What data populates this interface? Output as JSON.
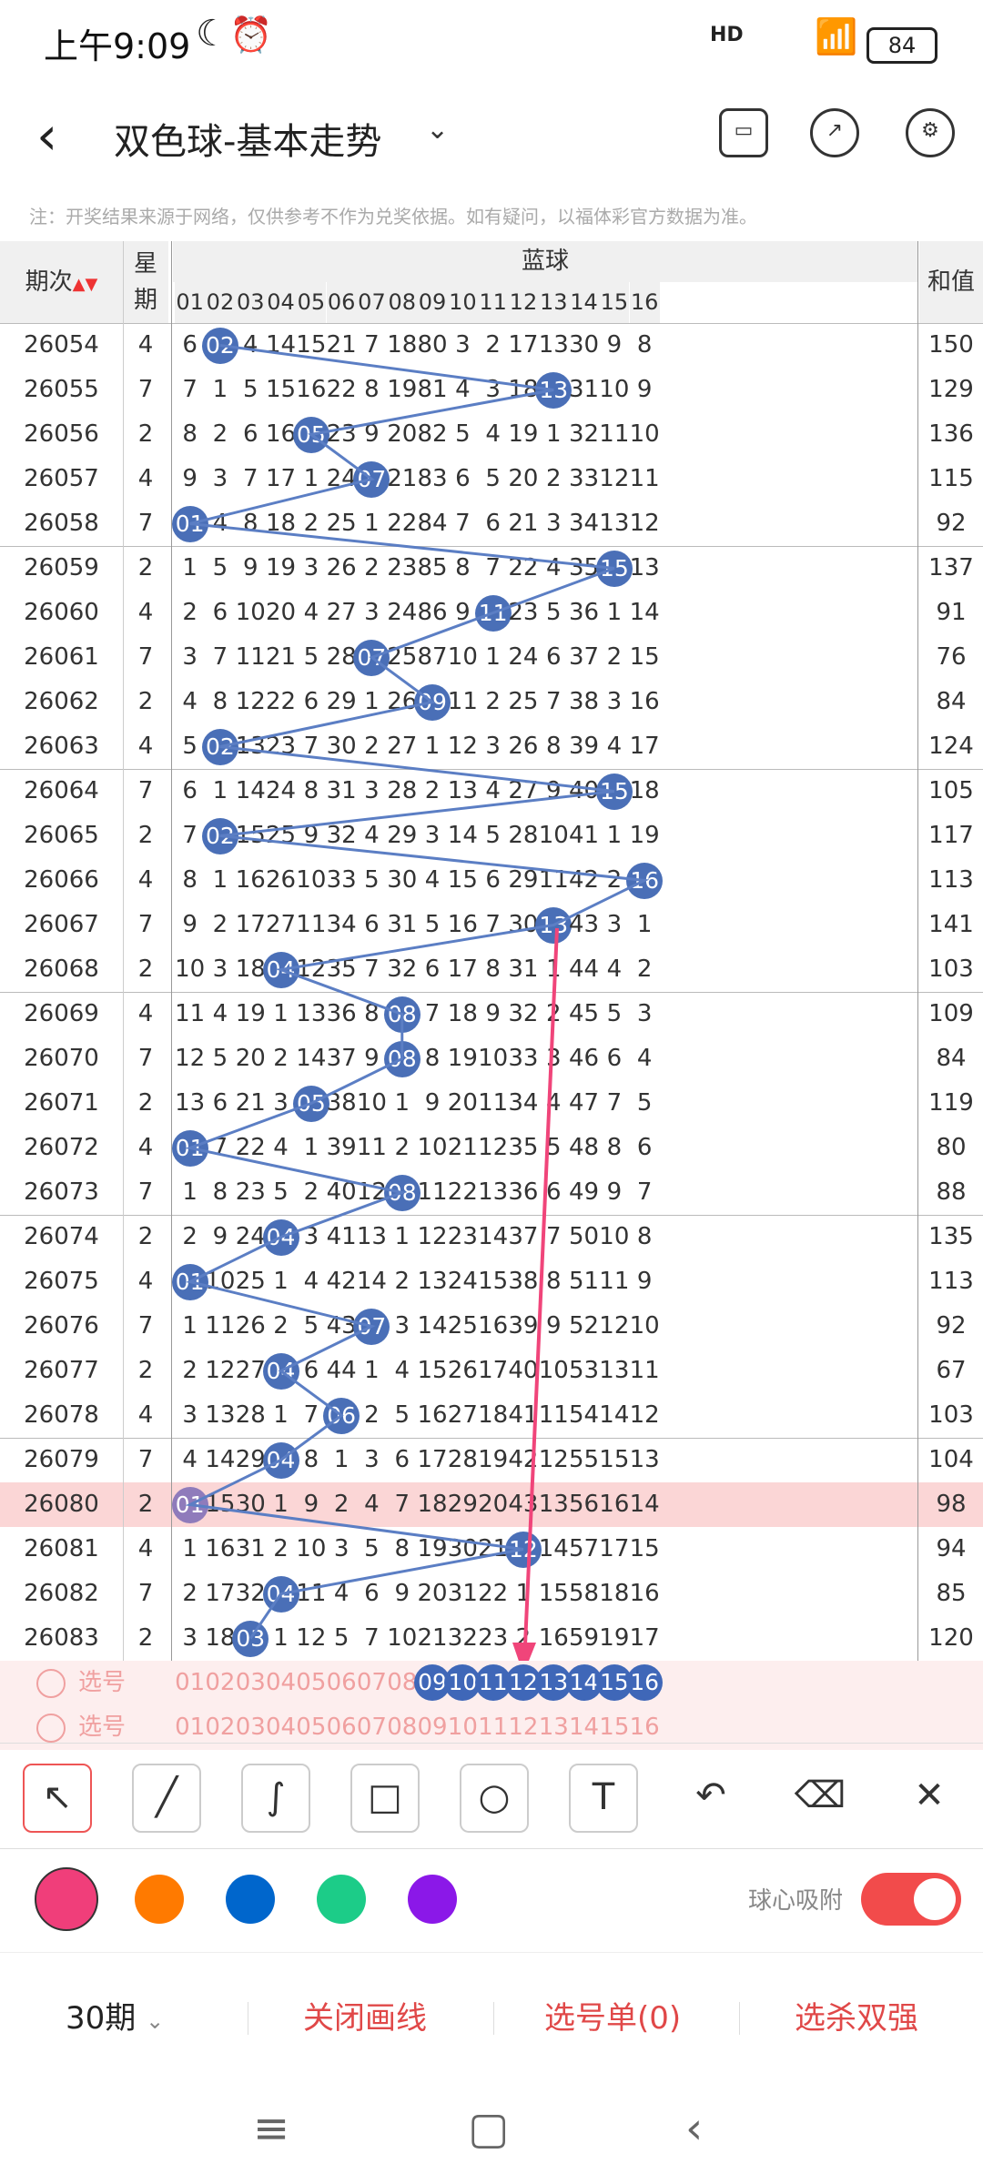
{
  "status": {
    "time": "上午9:09",
    "signal": "HD",
    "battery": "84"
  },
  "header": {
    "title": "双色球-基本走势",
    "back": "‹",
    "dropdown": "⌄"
  },
  "note": "注：开奖结果来源于网络，仅供参考不作为兑奖依据。如有疑问，以福体彩官方数据为准。",
  "table": {
    "col_issue": "期次",
    "col_week_1": "星",
    "col_week_2": "期",
    "col_blue": "蓝球",
    "col_sum": "和值",
    "blue_cols": [
      "01",
      "02",
      "03",
      "04",
      "05",
      "06",
      "07",
      "08",
      "09",
      "10",
      "11",
      "12",
      "13",
      "14",
      "15",
      "16"
    ],
    "rows": [
      {
        "issue": "26054",
        "week": "4",
        "sum": "150",
        "cells": [
          "6",
          "02",
          "4",
          "14",
          "15",
          "21",
          "7",
          "18",
          "80",
          "3",
          "2",
          "17",
          "13",
          "30",
          "9",
          "8"
        ],
        "hit": 2
      },
      {
        "issue": "26055",
        "week": "7",
        "sum": "129",
        "cells": [
          "7",
          "1",
          "5",
          "15",
          "16",
          "22",
          "8",
          "19",
          "81",
          "4",
          "3",
          "18",
          "13",
          "31",
          "10",
          "9"
        ],
        "hit": 13
      },
      {
        "issue": "26056",
        "week": "2",
        "sum": "136",
        "cells": [
          "8",
          "2",
          "6",
          "16",
          "05",
          "23",
          "9",
          "20",
          "82",
          "5",
          "4",
          "19",
          "1",
          "32",
          "11",
          "10"
        ],
        "hit": 5
      },
      {
        "issue": "26057",
        "week": "4",
        "sum": "115",
        "cells": [
          "9",
          "3",
          "7",
          "17",
          "1",
          "24",
          "07",
          "21",
          "83",
          "6",
          "5",
          "20",
          "2",
          "33",
          "12",
          "11"
        ],
        "hit": 7
      },
      {
        "issue": "26058",
        "week": "7",
        "sum": "92",
        "cells": [
          "01",
          "4",
          "8",
          "18",
          "2",
          "25",
          "1",
          "22",
          "84",
          "7",
          "6",
          "21",
          "3",
          "34",
          "13",
          "12"
        ],
        "hit": 1
      },
      {
        "issue": "26059",
        "week": "2",
        "sum": "137",
        "cells": [
          "1",
          "5",
          "9",
          "19",
          "3",
          "26",
          "2",
          "23",
          "85",
          "8",
          "7",
          "22",
          "4",
          "35",
          "15",
          "13"
        ],
        "hit": 15
      },
      {
        "issue": "26060",
        "week": "4",
        "sum": "91",
        "cells": [
          "2",
          "6",
          "10",
          "20",
          "4",
          "27",
          "3",
          "24",
          "86",
          "9",
          "11",
          "23",
          "5",
          "36",
          "1",
          "14"
        ],
        "hit": 11
      },
      {
        "issue": "26061",
        "week": "7",
        "sum": "76",
        "cells": [
          "3",
          "7",
          "11",
          "21",
          "5",
          "28",
          "07",
          "25",
          "87",
          "10",
          "1",
          "24",
          "6",
          "37",
          "2",
          "15"
        ],
        "hit": 7
      },
      {
        "issue": "26062",
        "week": "2",
        "sum": "84",
        "cells": [
          "4",
          "8",
          "12",
          "22",
          "6",
          "29",
          "1",
          "26",
          "09",
          "11",
          "2",
          "25",
          "7",
          "38",
          "3",
          "16"
        ],
        "hit": 9
      },
      {
        "issue": "26063",
        "week": "4",
        "sum": "124",
        "cells": [
          "5",
          "02",
          "13",
          "23",
          "7",
          "30",
          "2",
          "27",
          "1",
          "12",
          "3",
          "26",
          "8",
          "39",
          "4",
          "17"
        ],
        "hit": 2
      },
      {
        "issue": "26064",
        "week": "7",
        "sum": "105",
        "cells": [
          "6",
          "1",
          "14",
          "24",
          "8",
          "31",
          "3",
          "28",
          "2",
          "13",
          "4",
          "27",
          "9",
          "40",
          "15",
          "18"
        ],
        "hit": 15
      },
      {
        "issue": "26065",
        "week": "2",
        "sum": "117",
        "cells": [
          "7",
          "02",
          "15",
          "25",
          "9",
          "32",
          "4",
          "29",
          "3",
          "14",
          "5",
          "28",
          "10",
          "41",
          "1",
          "19"
        ],
        "hit": 2
      },
      {
        "issue": "26066",
        "week": "4",
        "sum": "113",
        "cells": [
          "8",
          "1",
          "16",
          "26",
          "10",
          "33",
          "5",
          "30",
          "4",
          "15",
          "6",
          "29",
          "11",
          "42",
          "2",
          "16"
        ],
        "hit": 16
      },
      {
        "issue": "26067",
        "week": "7",
        "sum": "141",
        "cells": [
          "9",
          "2",
          "17",
          "27",
          "11",
          "34",
          "6",
          "31",
          "5",
          "16",
          "7",
          "30",
          "13",
          "43",
          "3",
          "1"
        ],
        "hit": 13
      },
      {
        "issue": "26068",
        "week": "2",
        "sum": "103",
        "cells": [
          "10",
          "3",
          "18",
          "04",
          "12",
          "35",
          "7",
          "32",
          "6",
          "17",
          "8",
          "31",
          "1",
          "44",
          "4",
          "2"
        ],
        "hit": 4
      },
      {
        "issue": "26069",
        "week": "4",
        "sum": "109",
        "cells": [
          "11",
          "4",
          "19",
          "1",
          "13",
          "36",
          "8",
          "08",
          "7",
          "18",
          "9",
          "32",
          "2",
          "45",
          "5",
          "3"
        ],
        "hit": 8
      },
      {
        "issue": "26070",
        "week": "7",
        "sum": "84",
        "cells": [
          "12",
          "5",
          "20",
          "2",
          "14",
          "37",
          "9",
          "08",
          "8",
          "19",
          "10",
          "33",
          "3",
          "46",
          "6",
          "4"
        ],
        "hit": 8
      },
      {
        "issue": "26071",
        "week": "2",
        "sum": "119",
        "cells": [
          "13",
          "6",
          "21",
          "3",
          "05",
          "38",
          "10",
          "1",
          "9",
          "20",
          "11",
          "34",
          "4",
          "47",
          "7",
          "5"
        ],
        "hit": 5
      },
      {
        "issue": "26072",
        "week": "4",
        "sum": "80",
        "cells": [
          "01",
          "7",
          "22",
          "4",
          "1",
          "39",
          "11",
          "2",
          "10",
          "21",
          "12",
          "35",
          "5",
          "48",
          "8",
          "6"
        ],
        "hit": 1
      },
      {
        "issue": "26073",
        "week": "7",
        "sum": "88",
        "cells": [
          "1",
          "8",
          "23",
          "5",
          "2",
          "40",
          "12",
          "08",
          "11",
          "22",
          "13",
          "36",
          "6",
          "49",
          "9",
          "7"
        ],
        "hit": 8
      },
      {
        "issue": "26074",
        "week": "2",
        "sum": "135",
        "cells": [
          "2",
          "9",
          "24",
          "04",
          "3",
          "41",
          "13",
          "1",
          "12",
          "23",
          "14",
          "37",
          "7",
          "50",
          "10",
          "8"
        ],
        "hit": 4
      },
      {
        "issue": "26075",
        "week": "4",
        "sum": "113",
        "cells": [
          "01",
          "10",
          "25",
          "1",
          "4",
          "42",
          "14",
          "2",
          "13",
          "24",
          "15",
          "38",
          "8",
          "51",
          "11",
          "9"
        ],
        "hit": 1
      },
      {
        "issue": "26076",
        "week": "7",
        "sum": "92",
        "cells": [
          "1",
          "11",
          "26",
          "2",
          "5",
          "43",
          "07",
          "3",
          "14",
          "25",
          "16",
          "39",
          "9",
          "52",
          "12",
          "10"
        ],
        "hit": 7
      },
      {
        "issue": "26077",
        "week": "2",
        "sum": "67",
        "cells": [
          "2",
          "12",
          "27",
          "04",
          "6",
          "44",
          "1",
          "4",
          "15",
          "26",
          "17",
          "40",
          "10",
          "53",
          "13",
          "11"
        ],
        "hit": 4
      },
      {
        "issue": "26078",
        "week": "4",
        "sum": "103",
        "cells": [
          "3",
          "13",
          "28",
          "1",
          "7",
          "06",
          "2",
          "5",
          "16",
          "27",
          "18",
          "41",
          "11",
          "54",
          "14",
          "12"
        ],
        "hit": 6
      },
      {
        "issue": "26079",
        "week": "7",
        "sum": "104",
        "cells": [
          "4",
          "14",
          "29",
          "04",
          "8",
          "1",
          "3",
          "6",
          "17",
          "28",
          "19",
          "42",
          "12",
          "55",
          "15",
          "13"
        ],
        "hit": 4
      },
      {
        "issue": "26080",
        "week": "2",
        "sum": "98",
        "cells": [
          "01",
          "15",
          "30",
          "1",
          "9",
          "2",
          "4",
          "7",
          "18",
          "29",
          "20",
          "43",
          "13",
          "56",
          "16",
          "14"
        ],
        "hit": 1
      },
      {
        "issue": "26081",
        "week": "4",
        "sum": "94",
        "cells": [
          "1",
          "16",
          "31",
          "2",
          "10",
          "3",
          "5",
          "8",
          "19",
          "30",
          "21",
          "12",
          "14",
          "57",
          "17",
          "15"
        ],
        "hit": 12
      },
      {
        "issue": "26082",
        "week": "7",
        "sum": "85",
        "cells": [
          "2",
          "17",
          "32",
          "04",
          "11",
          "4",
          "6",
          "9",
          "20",
          "31",
          "22",
          "1",
          "15",
          "58",
          "18",
          "16"
        ],
        "hit": 4
      },
      {
        "issue": "26083",
        "week": "2",
        "sum": "120",
        "cells": [
          "3",
          "18",
          "03",
          "1",
          "12",
          "5",
          "7",
          "10",
          "21",
          "32",
          "23",
          "2",
          "16",
          "59",
          "19",
          "17"
        ],
        "hit": 3
      }
    ],
    "pick_label": "选号",
    "pick_row1": [
      "01",
      "02",
      "03",
      "04",
      "05",
      "06",
      "07",
      "08",
      "09",
      "10",
      "11",
      "12",
      "13",
      "14",
      "15",
      "16"
    ],
    "pick_row2": [
      "01",
      "02",
      "03",
      "04",
      "05",
      "06",
      "07",
      "08",
      "09",
      "10",
      "11",
      "12",
      "13",
      "14",
      "15",
      "16"
    ]
  },
  "tools": [
    "cursor",
    "line",
    "curve",
    "rectangle",
    "circle",
    "text",
    "undo",
    "eraser",
    "clear"
  ],
  "colors": [
    "#f03e7a",
    "#ff7a00",
    "#0066cc",
    "#1ccc88",
    "#8b18e8"
  ],
  "snap_label": "球心吸附",
  "actions": {
    "period": "30期",
    "close": "关闭画线",
    "picklist": "选号单(0)",
    "kill": "选杀双强"
  }
}
